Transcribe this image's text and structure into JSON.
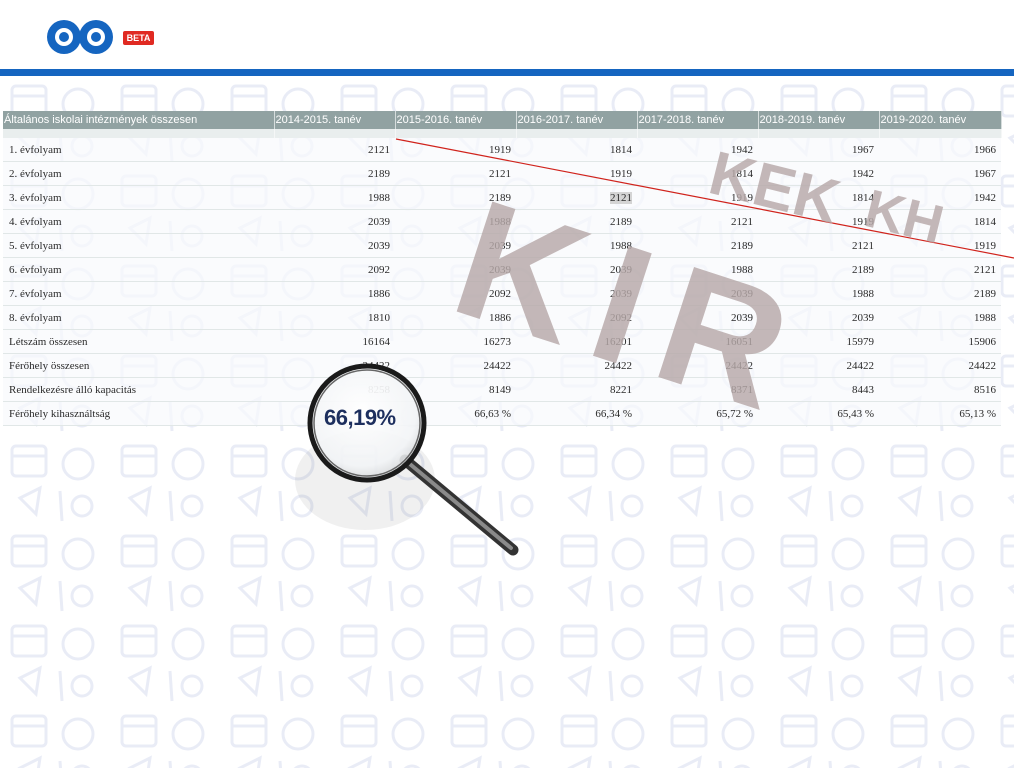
{
  "header": {
    "beta_label": "BETA"
  },
  "table": {
    "columns": [
      "Általános iskolai intézmények összesen",
      "2014-2015. tanév",
      "2015-2016. tanév",
      "2016-2017. tanév",
      "2017-2018. tanév",
      "2018-2019. tanév",
      "2019-2020. tanév"
    ],
    "rows": [
      {
        "label": "1. évfolyam",
        "values": [
          "2121",
          "1919",
          "1814",
          "1942",
          "1967",
          "1966"
        ]
      },
      {
        "label": "2. évfolyam",
        "values": [
          "2189",
          "2121",
          "1919",
          "1814",
          "1942",
          "1967"
        ]
      },
      {
        "label": "3. évfolyam",
        "values": [
          "1988",
          "2189",
          "2121",
          "1919",
          "1814",
          "1942"
        ]
      },
      {
        "label": "4. évfolyam",
        "values": [
          "2039",
          "1988",
          "2189",
          "2121",
          "1919",
          "1814"
        ]
      },
      {
        "label": "5. évfolyam",
        "values": [
          "2039",
          "2039",
          "1988",
          "2189",
          "2121",
          "1919"
        ]
      },
      {
        "label": "6. évfolyam",
        "values": [
          "2092",
          "2039",
          "2039",
          "1988",
          "2189",
          "2121"
        ]
      },
      {
        "label": "7. évfolyam",
        "values": [
          "1886",
          "2092",
          "2039",
          "2039",
          "1988",
          "2189"
        ]
      },
      {
        "label": "8. évfolyam",
        "values": [
          "1810",
          "1886",
          "2092",
          "2039",
          "2039",
          "1988"
        ]
      },
      {
        "label": "Létszám összesen",
        "values": [
          "16164",
          "16273",
          "16201",
          "16051",
          "15979",
          "15906"
        ]
      },
      {
        "label": "Férőhely összesen",
        "values": [
          "24422",
          "24422",
          "24422",
          "24422",
          "24422",
          "24422"
        ]
      },
      {
        "label": "Rendelkezésre álló kapacitás",
        "values": [
          "8258",
          "8149",
          "8221",
          "8371",
          "8443",
          "8516"
        ]
      },
      {
        "label": "Férőhely kihasználtság",
        "values": [
          "",
          "66,63 %",
          "66,34 %",
          "65,72 %",
          "65,43 %",
          "65,13 %"
        ]
      }
    ]
  },
  "overlay": {
    "watermark_kir": "KIR",
    "watermark_kek": "KEK",
    "watermark_kh": "KH",
    "magnified_value": "66,19%",
    "watermark_color": "#b7a9a9",
    "line_color": "#d0231c"
  },
  "colors": {
    "brand_blue": "#1565c0",
    "beta_red": "#e02a22",
    "header_gray": "#91a2a2"
  }
}
